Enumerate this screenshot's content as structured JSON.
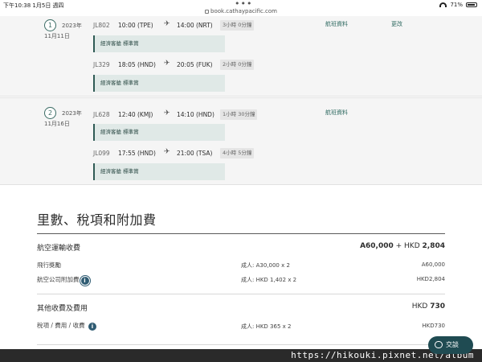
{
  "status": {
    "time": "下午10:38",
    "date": "1月5日 週四",
    "url": "book.cathaypacific.com",
    "battery": "71%"
  },
  "segments": [
    {
      "index": "1",
      "year": "2023年",
      "date": "11月11日",
      "flight_info_link": "航班資料",
      "change_link": "更改",
      "flights": [
        {
          "flight": "JL802",
          "dep": "10:00 (TPE)",
          "arr": "14:00 (NRT)",
          "duration": "3小時 0分鐘",
          "cabin": "經濟客艙 標準賞"
        },
        {
          "flight": "JL329",
          "dep": "18:05 (HND)",
          "arr": "20:05 (FUK)",
          "duration": "2小時 0分鐘",
          "cabin": "經濟客艙 標準賞"
        }
      ]
    },
    {
      "index": "2",
      "year": "2023年",
      "date": "11月16日",
      "flight_info_link": "航班資料",
      "flights": [
        {
          "flight": "JL628",
          "dep": "12:40 (KMJ)",
          "arr": "14:10 (HND)",
          "duration": "1小時 30分鐘",
          "cabin": "經濟客艙 標準賞"
        },
        {
          "flight": "JL099",
          "dep": "17:55 (HND)",
          "arr": "21:00 (TSA)",
          "duration": "4小時 5分鐘",
          "cabin": "經濟客艙 標準賞"
        }
      ]
    }
  ],
  "fare": {
    "title": "里數、稅項和附加費",
    "air_transport": {
      "label": "航空運輸收費",
      "total_miles": "A60,000",
      "total_plus": "+ HKD",
      "total_hkd": "2,804",
      "lines": [
        {
          "label": "飛行獎勵",
          "detail": "成人: A30,000 x 2",
          "amount": "A60,000"
        },
        {
          "label": "航空公司附加費",
          "detail": "成人: HKD 1,402 x 2",
          "amount": "HKD2,804"
        }
      ]
    },
    "other": {
      "label": "其他收費及費用",
      "total_prefix": "HKD",
      "total_value": "730",
      "lines": [
        {
          "label": "稅項 / 費用 / 收費",
          "detail": "成人: HKD 365 x 2",
          "amount": "HKD730"
        }
      ]
    }
  },
  "chat": {
    "label": "交談"
  },
  "watermark": "https://hikouki.pixnet.net/album",
  "icons": {
    "plane": "plane-icon",
    "info": "info-icon",
    "chat": "chat-icon",
    "wifi": "wifi-icon",
    "battery": "battery-icon"
  }
}
